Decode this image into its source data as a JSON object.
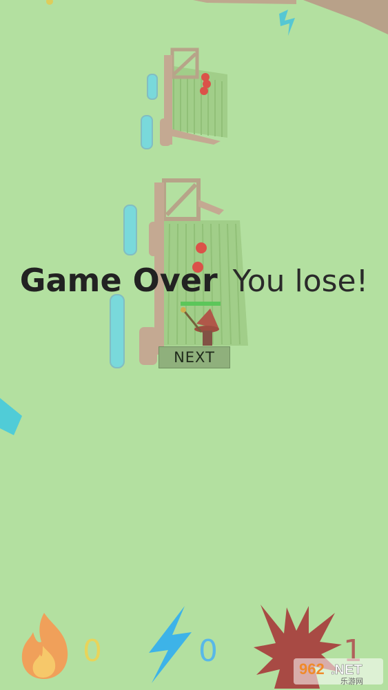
{
  "game": {
    "status_title": "Game Over",
    "status_message": "You lose!",
    "next_label": "NEXT"
  },
  "resources": {
    "fire": {
      "icon": "fire-icon",
      "count": "0",
      "color": "#f0a05a",
      "count_color": "#e8d45a"
    },
    "lightning": {
      "icon": "lightning-icon",
      "count": "0",
      "color": "#3db3e8",
      "count_color": "#58b8e8"
    },
    "explosion": {
      "icon": "explosion-icon",
      "count": "1",
      "color": "#a84a44",
      "count_color": "#b0605a"
    }
  },
  "watermark": {
    "brand": "962.NET",
    "sub": "乐游网"
  }
}
